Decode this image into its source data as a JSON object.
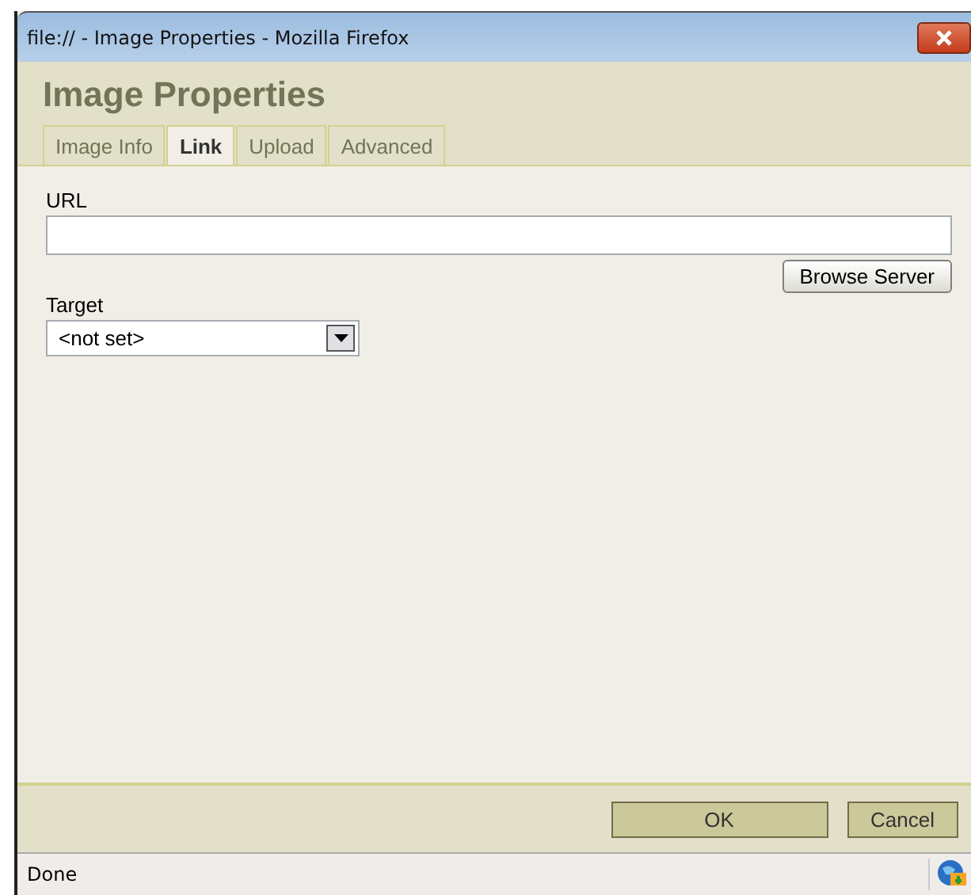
{
  "window": {
    "title": "file:// - Image Properties - Mozilla Firefox"
  },
  "dialog": {
    "title": "Image Properties"
  },
  "tabs": [
    {
      "label": "Image Info",
      "selected": false
    },
    {
      "label": "Link",
      "selected": true
    },
    {
      "label": "Upload",
      "selected": false
    },
    {
      "label": "Advanced",
      "selected": false
    }
  ],
  "url": {
    "label": "URL"
  },
  "browse_button": "Browse Server",
  "target": {
    "label": "Target",
    "value": "<not set>"
  },
  "buttons": [
    {
      "label": "OK",
      "kind": "primary"
    },
    {
      "label": "Cancel",
      "kind": "secondary"
    }
  ],
  "status_bar": {
    "text": "Done"
  }
}
